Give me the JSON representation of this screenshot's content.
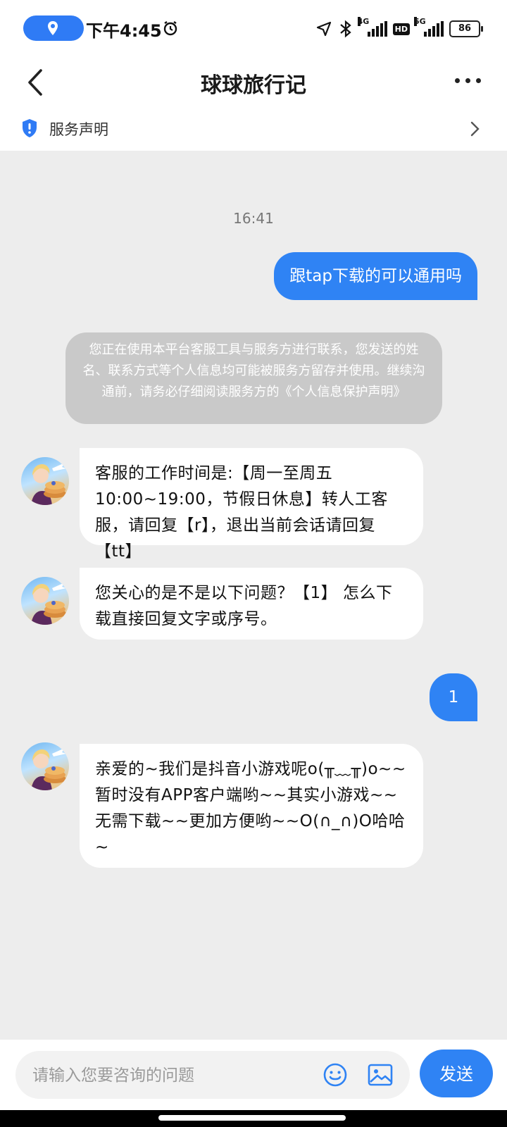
{
  "status_bar": {
    "time": "下午4:45",
    "network_left": "4G",
    "network_right": "5G",
    "hd_label": "HD",
    "battery": "86"
  },
  "header": {
    "title": "球球旅行记"
  },
  "notice_bar": {
    "label": "服务声明"
  },
  "chat": {
    "timestamp": "16:41",
    "messages": [
      {
        "from": "user",
        "text": "跟tap下载的可以通用吗"
      },
      {
        "from": "system",
        "text": "您正在使用本平台客服工具与服务方进行联系，您发送的姓名、联系方式等个人信息均可能被服务方留存并使用。继续沟通前，请务必仔细阅读服务方的《个人信息保护声明》"
      },
      {
        "from": "agent",
        "text": "客服的工作时间是:【周一至周五10:00~19:00，节假日休息】转人工客服，请回复【r】，退出当前会话请回复【tt】"
      },
      {
        "from": "agent",
        "text": "您关心的是不是以下问题？【1】 怎么下载直接回复文字或序号。"
      },
      {
        "from": "user",
        "text": "1"
      },
      {
        "from": "agent",
        "text": "亲爱的~我们是抖音小游戏呢o(╥﹏╥)o~~暂时没有APP客户端哟~~其实小游戏~~无需下载~~更加方便哟~~O(∩_∩)O哈哈~"
      }
    ]
  },
  "input_bar": {
    "placeholder": "请输入您要咨询的问题",
    "send_label": "发送"
  },
  "colors": {
    "accent": "#2f83f4",
    "system_bubble": "#c9c9c9",
    "background": "#ededed"
  }
}
